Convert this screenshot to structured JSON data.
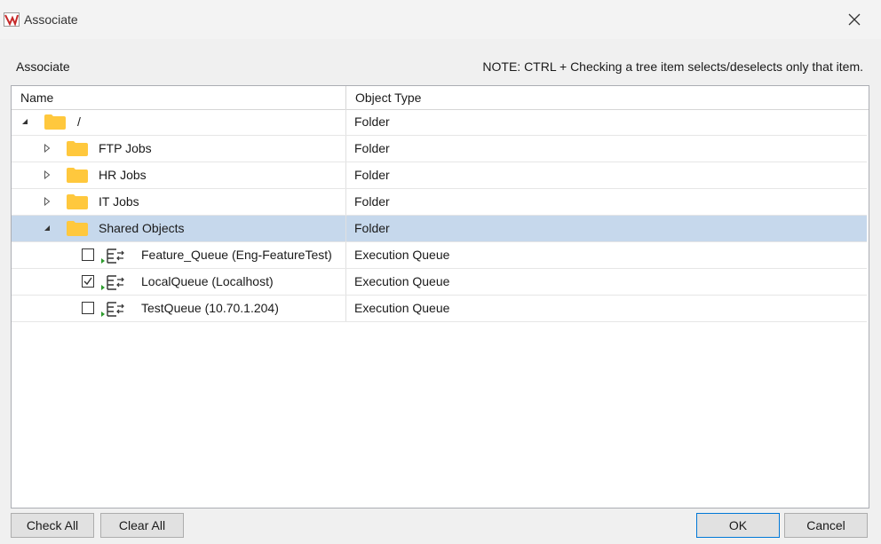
{
  "window": {
    "title": "Associate",
    "icon": "app-logo-icon",
    "close_icon": "close-icon"
  },
  "section_label": "Associate",
  "note": "NOTE: CTRL + Checking a tree item selects/deselects only that item.",
  "columns": {
    "name": "Name",
    "type": "Object Type"
  },
  "rows": [
    {
      "name": "/",
      "type": "Folder"
    },
    {
      "name": "FTP Jobs",
      "type": "Folder"
    },
    {
      "name": "HR Jobs",
      "type": "Folder"
    },
    {
      "name": "IT Jobs",
      "type": "Folder"
    },
    {
      "name": "Shared Objects",
      "type": "Folder",
      "selected": true
    },
    {
      "name": "Feature_Queue (Eng-FeatureTest)",
      "type": "Execution Queue",
      "checked": false
    },
    {
      "name": "LocalQueue (Localhost)",
      "type": "Execution Queue",
      "checked": true
    },
    {
      "name": "TestQueue (10.70.1.204)",
      "type": "Execution Queue",
      "checked": false
    }
  ],
  "buttons": {
    "check_all": "Check All",
    "clear_all": "Clear All",
    "ok": "OK",
    "cancel": "Cancel"
  },
  "colors": {
    "selected_row": "#c6d8ec",
    "folder": "#ffc83d",
    "accent": "#0078d7"
  }
}
